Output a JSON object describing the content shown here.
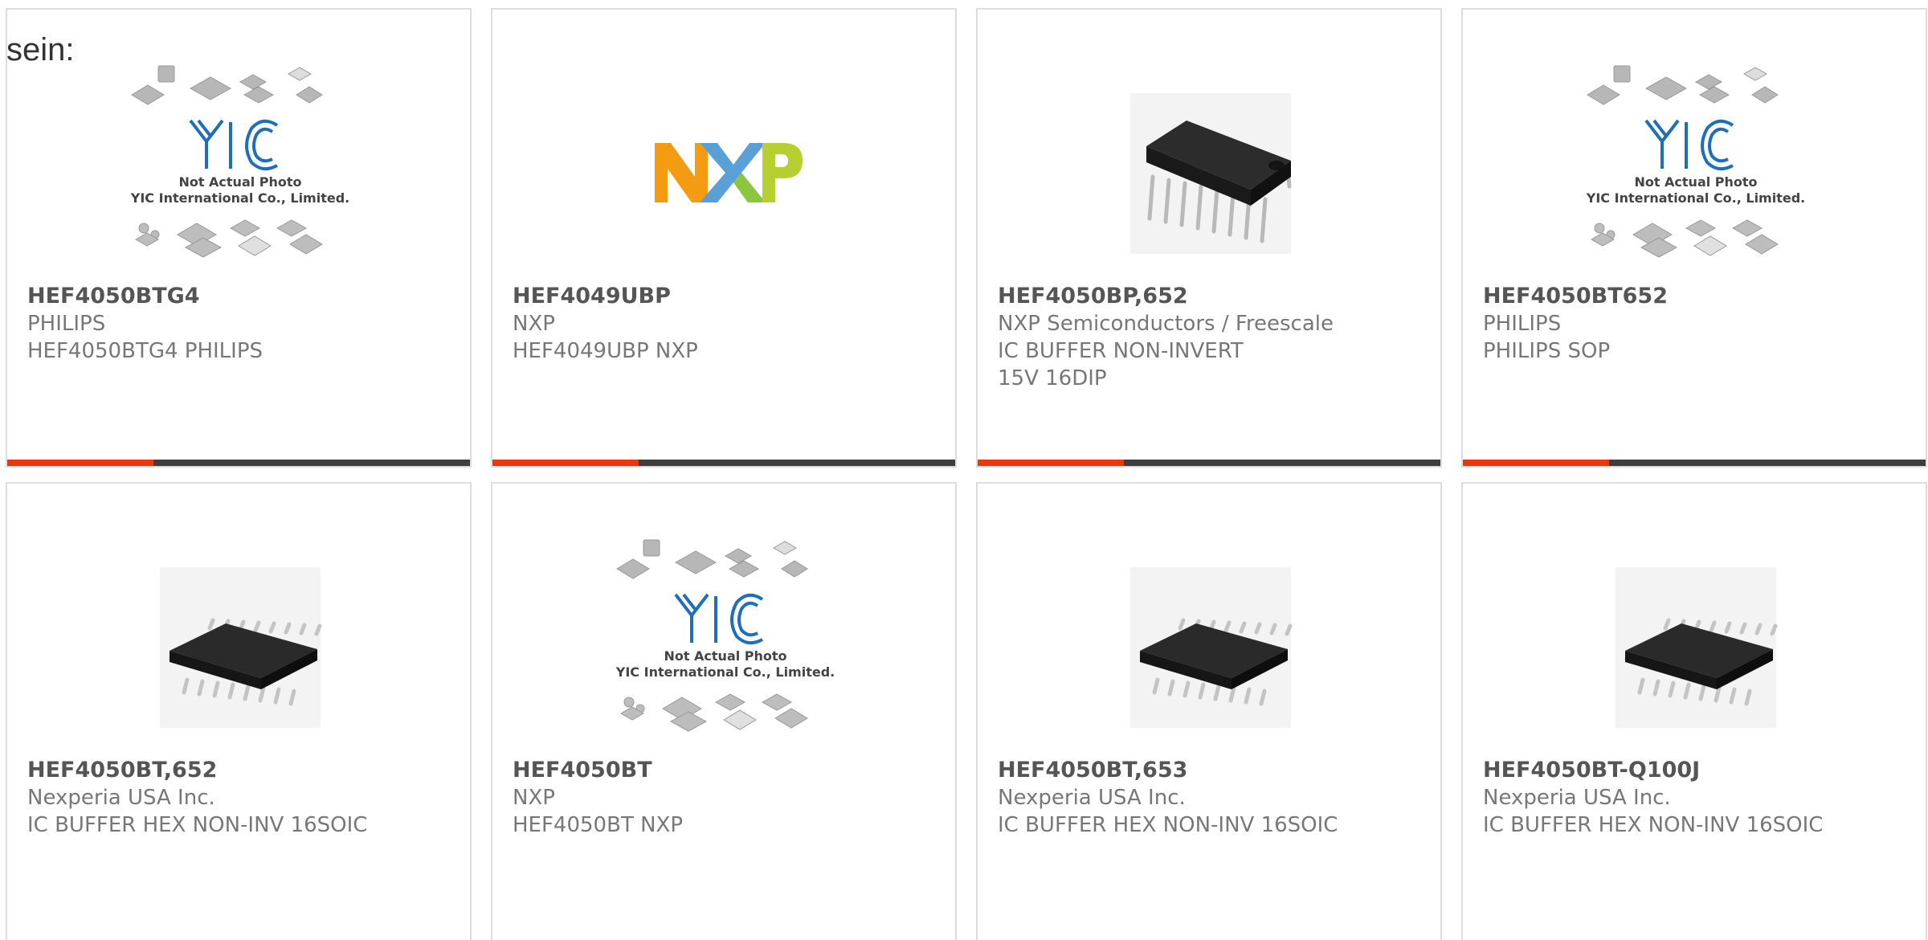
{
  "intro_text": "sein:",
  "colors": {
    "accent": "#e8380d",
    "bar_dark": "#3d3d3d",
    "border": "#dddddd"
  },
  "products": [
    {
      "part": "HEF4050BTG4",
      "manufacturer": "PHILIPS",
      "description": "HEF4050BTG4 PHILIPS",
      "image": "yic-placeholder",
      "placeholder_line1": "Not Actual Photo",
      "placeholder_line2": "YIC International Co., Limited."
    },
    {
      "part": "HEF4049UBP",
      "manufacturer": "NXP",
      "description": "HEF4049UBP NXP",
      "image": "nxp-logo",
      "logo_text": "NXP"
    },
    {
      "part": "HEF4050BP,652",
      "manufacturer": "NXP Semiconductors / Freescale",
      "description": "IC BUFFER NON-INVERT 15V 16DIP",
      "image": "dip-chip"
    },
    {
      "part": "HEF4050BT652",
      "manufacturer": "PHILIPS",
      "description": "PHILIPS SOP",
      "image": "yic-placeholder",
      "placeholder_line1": "Not Actual Photo",
      "placeholder_line2": "YIC International Co., Limited."
    },
    {
      "part": "HEF4050BT,652",
      "manufacturer": "Nexperia USA Inc.",
      "description": "IC BUFFER HEX NON-INV 16SOIC",
      "image": "soic-chip"
    },
    {
      "part": "HEF4050BT",
      "manufacturer": "NXP",
      "description": "HEF4050BT NXP",
      "image": "yic-placeholder",
      "placeholder_line1": "Not Actual Photo",
      "placeholder_line2": "YIC International Co., Limited."
    },
    {
      "part": "HEF4050BT,653",
      "manufacturer": "Nexperia USA Inc.",
      "description": "IC BUFFER HEX NON-INV 16SOIC",
      "image": "soic-chip"
    },
    {
      "part": "HEF4050BT-Q100J",
      "manufacturer": "Nexperia USA Inc.",
      "description": "IC BUFFER HEX NON-INV 16SOIC",
      "image": "soic-chip"
    }
  ]
}
